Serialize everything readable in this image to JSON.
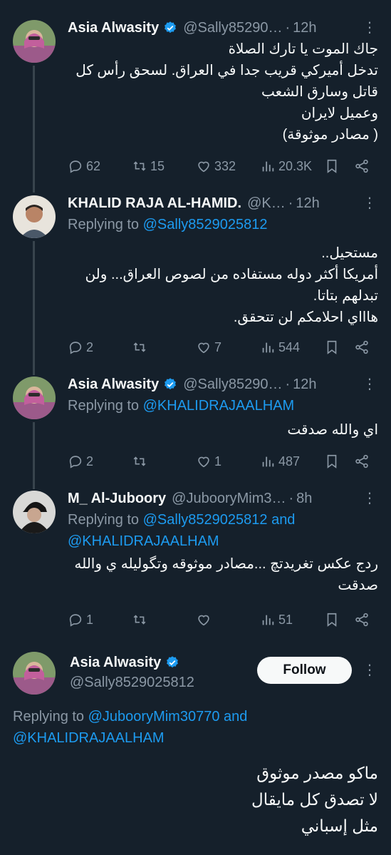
{
  "colors": {
    "background": "#15202b",
    "accent": "#1d9bf0",
    "muted": "#8b98a5"
  },
  "tweets": [
    {
      "name": "Asia Alwasity",
      "handle": "@Sally85290…",
      "time": "12h",
      "text": "جاك الموت يا تارك الصلاة\nتدخل أميركي قريب جدا في العراق. لسحق رأس كل قاتل وسارق الشعب\nوعميل لايران\n( مصادر موثوقة)",
      "replies": "62",
      "retweets": "15",
      "likes": "332",
      "views": "20.3K"
    },
    {
      "name": "KHALID RAJA AL-HAMID.",
      "handle": "@K…",
      "time": "12h",
      "replying_prefix": "Replying to ",
      "replying_to": "@Sally8529025812",
      "text": "مستحيل..\nأمريكا  أكثر دوله مستفاده من لصوص العراق... ولن تبدلهم  بتاتا.\nهاااي احلامكم لن تتحقق.",
      "replies": "2",
      "retweets": "",
      "likes": "7",
      "views": "544"
    },
    {
      "name": "Asia Alwasity",
      "handle": "@Sally85290…",
      "time": "12h",
      "replying_prefix": "Replying to ",
      "replying_to": "@KHALIDRAJAALHAM",
      "text": "اي والله صدقت",
      "replies": "2",
      "retweets": "",
      "likes": "1",
      "views": "487"
    },
    {
      "name": "M_ Al-Juboory",
      "handle": "@JubooryMim3…",
      "time": "8h",
      "replying_prefix": "Replying to ",
      "replying_to": "@Sally8529025812 and @KHALIDRAJAALHAM",
      "text": "ردج عكس تغريدتچ ...مصادر موثوقه وتگوليله  ي والله صدقت",
      "replies": "1",
      "retweets": "",
      "likes": "",
      "views": "51"
    }
  ],
  "focused": {
    "name": "Asia Alwasity",
    "handle": "@Sally8529025812",
    "follow_label": "Follow",
    "replying_prefix": "Replying to ",
    "replying_to": "@JubooryMim30770 and @KHALIDRAJAALHAM",
    "text": "ماكو مصدر موثوق\nلا تصدق كل مايقال\nمثل إسباني"
  }
}
